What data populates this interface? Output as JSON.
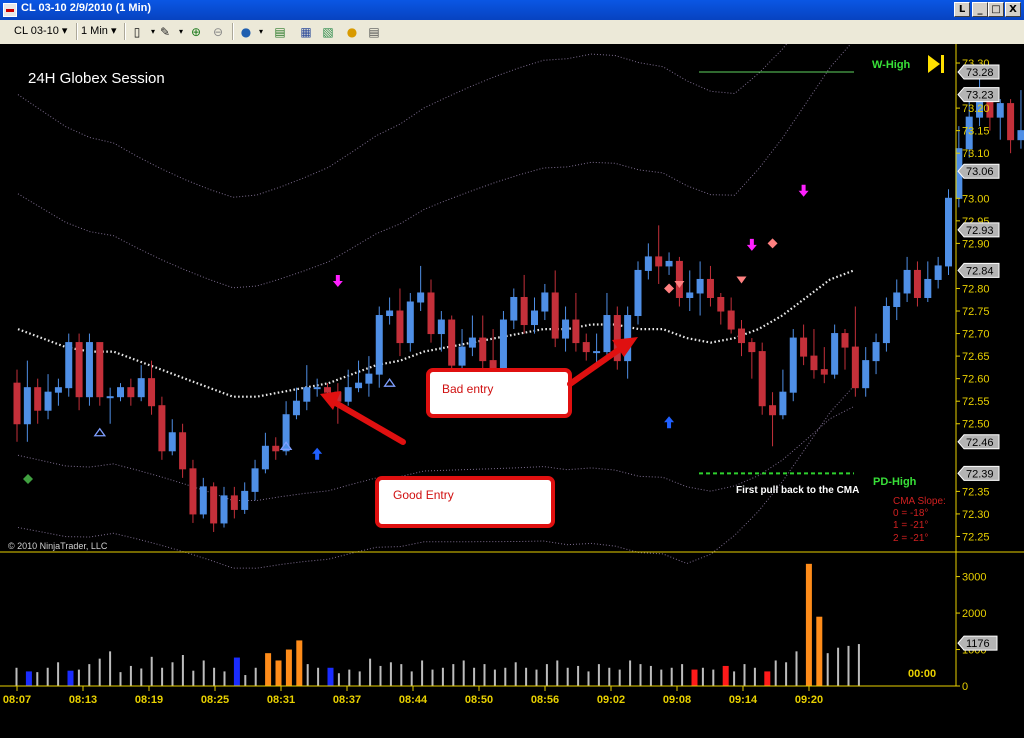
{
  "window": {
    "title": "CL 03-10  2/9/2010 (1 Min)",
    "controls": [
      "L",
      "_",
      "□",
      "X"
    ]
  },
  "toolbar": {
    "instrument": "CL 03-10",
    "interval": "1 Min"
  },
  "chart_data": {
    "type": "candlestick",
    "title": "24H Globex Session",
    "copyright": "© 2010 NinjaTrader, LLC",
    "ylim": [
      72.22,
      73.32
    ],
    "y_ticks": [
      "73.30",
      "73.20",
      "73.15",
      "73.10",
      "73.00",
      "72.95",
      "72.90",
      "72.80",
      "72.75",
      "72.70",
      "72.65",
      "72.60",
      "72.55",
      "72.50",
      "72.35",
      "72.30",
      "72.25"
    ],
    "price_markers": [
      {
        "label": "73.28",
        "value": 73.28
      },
      {
        "label": "73.23",
        "value": 73.23
      },
      {
        "label": "73.06",
        "value": 73.06
      },
      {
        "label": "72.93",
        "value": 72.93
      },
      {
        "label": "72.84",
        "value": 72.84
      },
      {
        "label": "72.46",
        "value": 72.46
      },
      {
        "label": "72.39",
        "value": 72.39
      }
    ],
    "x_ticks": [
      "08:07",
      "08:13",
      "08:19",
      "08:25",
      "08:31",
      "08:37",
      "08:44",
      "08:50",
      "08:56",
      "09:02",
      "09:08",
      "09:14",
      "09:20"
    ],
    "candles": [
      [
        72.59,
        72.5,
        72.62,
        72.46
      ],
      [
        72.5,
        72.58,
        72.64,
        72.46
      ],
      [
        72.58,
        72.53,
        72.6,
        72.5
      ],
      [
        72.53,
        72.57,
        72.61,
        72.51
      ],
      [
        72.57,
        72.58,
        72.6,
        72.54
      ],
      [
        72.58,
        72.68,
        72.7,
        72.56
      ],
      [
        72.68,
        72.56,
        72.7,
        72.53
      ],
      [
        72.56,
        72.68,
        72.7,
        72.54
      ],
      [
        72.68,
        72.56,
        72.68,
        72.54
      ],
      [
        72.56,
        72.56,
        72.58,
        72.5
      ],
      [
        72.56,
        72.58,
        72.59,
        72.55
      ],
      [
        72.58,
        72.56,
        72.6,
        72.54
      ],
      [
        72.56,
        72.6,
        72.63,
        72.55
      ],
      [
        72.6,
        72.54,
        72.64,
        72.52
      ],
      [
        72.54,
        72.44,
        72.56,
        72.42
      ],
      [
        72.44,
        72.48,
        72.51,
        72.43
      ],
      [
        72.48,
        72.4,
        72.5,
        72.38
      ],
      [
        72.4,
        72.3,
        72.42,
        72.28
      ],
      [
        72.3,
        72.36,
        72.38,
        72.29
      ],
      [
        72.36,
        72.28,
        72.37,
        72.26
      ],
      [
        72.28,
        72.34,
        72.36,
        72.27
      ],
      [
        72.34,
        72.31,
        72.36,
        72.29
      ],
      [
        72.31,
        72.35,
        72.37,
        72.3
      ],
      [
        72.35,
        72.4,
        72.42,
        72.33
      ],
      [
        72.4,
        72.45,
        72.48,
        72.39
      ],
      [
        72.45,
        72.44,
        72.47,
        72.42
      ],
      [
        72.44,
        72.52,
        72.55,
        72.43
      ],
      [
        72.52,
        72.55,
        72.58,
        72.51
      ],
      [
        72.55,
        72.58,
        72.63,
        72.53
      ],
      [
        72.58,
        72.58,
        72.6,
        72.56
      ],
      [
        72.58,
        72.57,
        72.59,
        72.55
      ],
      [
        72.57,
        72.55,
        72.59,
        72.5
      ],
      [
        72.55,
        72.58,
        72.62,
        72.54
      ],
      [
        72.58,
        72.59,
        72.64,
        72.57
      ],
      [
        72.59,
        72.61,
        72.65,
        72.56
      ],
      [
        72.61,
        72.74,
        72.76,
        72.58
      ],
      [
        72.74,
        72.75,
        72.78,
        72.72
      ],
      [
        72.75,
        72.68,
        72.8,
        72.65
      ],
      [
        72.68,
        72.77,
        72.79,
        72.66
      ],
      [
        72.77,
        72.79,
        72.85,
        72.75
      ],
      [
        72.79,
        72.7,
        72.82,
        72.68
      ],
      [
        72.7,
        72.73,
        72.75,
        72.66
      ],
      [
        72.73,
        72.63,
        72.74,
        72.6
      ],
      [
        72.63,
        72.67,
        72.71,
        72.61
      ],
      [
        72.67,
        72.69,
        72.74,
        72.65
      ],
      [
        72.69,
        72.64,
        72.74,
        72.62
      ],
      [
        72.64,
        72.62,
        72.71,
        72.6
      ],
      [
        72.62,
        72.73,
        72.75,
        72.6
      ],
      [
        72.73,
        72.78,
        72.8,
        72.71
      ],
      [
        72.78,
        72.72,
        72.83,
        72.7
      ],
      [
        72.72,
        72.75,
        72.78,
        72.7
      ],
      [
        72.75,
        72.79,
        72.81,
        72.73
      ],
      [
        72.79,
        72.69,
        72.84,
        72.67
      ],
      [
        72.69,
        72.73,
        72.76,
        72.66
      ],
      [
        72.73,
        72.68,
        72.79,
        72.66
      ],
      [
        72.68,
        72.66,
        72.7,
        72.64
      ],
      [
        72.66,
        72.66,
        72.7,
        72.63
      ],
      [
        72.66,
        72.74,
        72.79,
        72.64
      ],
      [
        72.74,
        72.64,
        72.76,
        72.62
      ],
      [
        72.64,
        72.74,
        72.76,
        72.6
      ],
      [
        72.74,
        72.84,
        72.86,
        72.72
      ],
      [
        72.84,
        72.87,
        72.9,
        72.82
      ],
      [
        72.87,
        72.85,
        72.94,
        72.81
      ],
      [
        72.85,
        72.86,
        72.88,
        72.83
      ],
      [
        72.86,
        72.78,
        72.87,
        72.76
      ],
      [
        72.78,
        72.79,
        72.84,
        72.75
      ],
      [
        72.79,
        72.82,
        72.86,
        72.74
      ],
      [
        72.82,
        72.78,
        72.85,
        72.76
      ],
      [
        72.78,
        72.75,
        72.79,
        72.72
      ],
      [
        72.75,
        72.71,
        72.78,
        72.7
      ],
      [
        72.71,
        72.68,
        72.73,
        72.65
      ],
      [
        72.68,
        72.66,
        72.69,
        72.6
      ],
      [
        72.66,
        72.54,
        72.68,
        72.52
      ],
      [
        72.54,
        72.52,
        72.57,
        72.45
      ],
      [
        72.52,
        72.57,
        72.62,
        72.51
      ],
      [
        72.57,
        72.69,
        72.71,
        72.55
      ],
      [
        72.69,
        72.65,
        72.72,
        72.63
      ],
      [
        72.65,
        72.62,
        72.71,
        72.6
      ],
      [
        72.62,
        72.61,
        72.67,
        72.59
      ],
      [
        72.61,
        72.7,
        72.72,
        72.6
      ],
      [
        72.7,
        72.67,
        72.71,
        72.62
      ],
      [
        72.67,
        72.58,
        72.76,
        72.56
      ],
      [
        72.58,
        72.64,
        72.67,
        72.56
      ],
      [
        72.64,
        72.68,
        72.7,
        72.61
      ],
      [
        72.68,
        72.76,
        72.78,
        72.66
      ],
      [
        72.76,
        72.79,
        72.82,
        72.73
      ],
      [
        72.79,
        72.84,
        72.87,
        72.77
      ],
      [
        72.84,
        72.78,
        72.86,
        72.76
      ],
      [
        72.78,
        72.82,
        72.86,
        72.77
      ],
      [
        72.82,
        72.85,
        72.87,
        72.8
      ],
      [
        72.85,
        73.0,
        73.02,
        72.83
      ],
      [
        73.0,
        73.11,
        73.16,
        72.98
      ],
      [
        73.11,
        73.18,
        73.23,
        73.09
      ],
      [
        73.18,
        73.22,
        73.28,
        73.16
      ],
      [
        73.22,
        73.18,
        73.24,
        73.15
      ],
      [
        73.18,
        73.21,
        73.22,
        73.13
      ],
      [
        73.21,
        73.13,
        73.22,
        73.1
      ],
      [
        73.13,
        73.15,
        73.24,
        73.11
      ],
      [
        73.15,
        73.06,
        73.16,
        73.05
      ]
    ],
    "volume_ticks": [
      "3000",
      "2000",
      "1000",
      "0"
    ],
    "volume_last_label": "1176",
    "volume_max": 3400,
    "volumes": [
      [
        500,
        "g"
      ],
      [
        400,
        "b"
      ],
      [
        380,
        "g"
      ],
      [
        500,
        "g"
      ],
      [
        650,
        "g"
      ],
      [
        420,
        "b"
      ],
      [
        450,
        "g"
      ],
      [
        600,
        "g"
      ],
      [
        750,
        "g"
      ],
      [
        950,
        "g"
      ],
      [
        380,
        "g"
      ],
      [
        550,
        "g"
      ],
      [
        480,
        "g"
      ],
      [
        800,
        "g"
      ],
      [
        500,
        "g"
      ],
      [
        650,
        "g"
      ],
      [
        850,
        "g"
      ],
      [
        420,
        "g"
      ],
      [
        700,
        "g"
      ],
      [
        500,
        "g"
      ],
      [
        400,
        "g"
      ],
      [
        780,
        "b"
      ],
      [
        300,
        "g"
      ],
      [
        500,
        "g"
      ],
      [
        900,
        "o"
      ],
      [
        700,
        "o"
      ],
      [
        1000,
        "o"
      ],
      [
        1250,
        "o"
      ],
      [
        600,
        "g"
      ],
      [
        500,
        "g"
      ],
      [
        500,
        "b"
      ],
      [
        350,
        "g"
      ],
      [
        450,
        "g"
      ],
      [
        400,
        "g"
      ],
      [
        750,
        "g"
      ],
      [
        550,
        "g"
      ],
      [
        650,
        "g"
      ],
      [
        600,
        "g"
      ],
      [
        400,
        "g"
      ],
      [
        700,
        "g"
      ],
      [
        450,
        "g"
      ],
      [
        500,
        "g"
      ],
      [
        600,
        "g"
      ],
      [
        700,
        "g"
      ],
      [
        500,
        "g"
      ],
      [
        600,
        "g"
      ],
      [
        450,
        "g"
      ],
      [
        500,
        "g"
      ],
      [
        650,
        "g"
      ],
      [
        500,
        "g"
      ],
      [
        450,
        "g"
      ],
      [
        600,
        "g"
      ],
      [
        700,
        "g"
      ],
      [
        500,
        "g"
      ],
      [
        550,
        "g"
      ],
      [
        400,
        "g"
      ],
      [
        600,
        "g"
      ],
      [
        500,
        "g"
      ],
      [
        450,
        "g"
      ],
      [
        700,
        "g"
      ],
      [
        600,
        "g"
      ],
      [
        550,
        "g"
      ],
      [
        450,
        "g"
      ],
      [
        500,
        "g"
      ],
      [
        600,
        "g"
      ],
      [
        450,
        "r"
      ],
      [
        500,
        "g"
      ],
      [
        450,
        "g"
      ],
      [
        550,
        "r"
      ],
      [
        400,
        "g"
      ],
      [
        600,
        "g"
      ],
      [
        500,
        "g"
      ],
      [
        400,
        "r"
      ],
      [
        700,
        "g"
      ],
      [
        650,
        "g"
      ],
      [
        950,
        "g"
      ],
      [
        3350,
        "o"
      ],
      [
        1900,
        "o"
      ],
      [
        900,
        "g"
      ],
      [
        1050,
        "g"
      ],
      [
        1100,
        "g"
      ],
      [
        1150,
        "g"
      ]
    ],
    "annotations": {
      "w_high": "W-High",
      "pd_high": "PD-High",
      "pullback": "First pull back to the CMA",
      "cma_slope_title": "CMA Slope:",
      "cma_slope": [
        "0 = -18°",
        "1 = -21°",
        "2 = -21°"
      ],
      "bad_entry": "Bad entry",
      "good_entry": "Good Entry",
      "clock": "00:00"
    },
    "colors": {
      "up": "#4f8fe6",
      "down": "#c4303a",
      "cma": "#e8e8e8",
      "bands": "#7d6d8f",
      "axis": "#e8d000",
      "w_high": "#5fd35f",
      "callout": "#e01010"
    }
  }
}
